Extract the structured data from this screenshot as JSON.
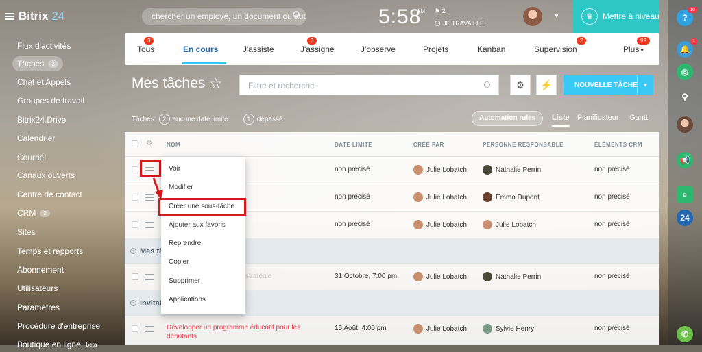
{
  "app": {
    "brand_main": "Bitrix",
    "brand_accent": "24",
    "accent": "#2fc6f6",
    "brand_color": "#2fc7c6",
    "danger": "#d7191b"
  },
  "header": {
    "search_placeholder": "chercher un employé, un document ou autre...",
    "clock": "5:58",
    "ampm": "AM",
    "flag_count": "2",
    "work_status": "JE TRAVAILLE",
    "upgrade_label": "Mettre à niveau"
  },
  "sidebar": {
    "items": [
      {
        "label": "Flux d'activités"
      },
      {
        "label": "Tâches",
        "count": "3"
      },
      {
        "label": "Chat et Appels"
      },
      {
        "label": "Groupes de travail"
      },
      {
        "label": "Bitrix24.Drive"
      },
      {
        "label": "Calendrier"
      },
      {
        "label": "Courriel"
      },
      {
        "label": "Canaux ouverts"
      },
      {
        "label": "Centre de contact"
      },
      {
        "label": "CRM",
        "count": "2"
      },
      {
        "label": "Sites"
      },
      {
        "label": "Temps et rapports"
      },
      {
        "label": "Abonnement"
      },
      {
        "label": "Utilisateurs"
      },
      {
        "label": "Paramètres"
      },
      {
        "label": "Procédure d'entreprise"
      },
      {
        "label": "Boutique en ligne",
        "sup": "beta"
      }
    ]
  },
  "tabs": {
    "items": [
      {
        "label": "Tous",
        "badge": "3"
      },
      {
        "label": "En cours"
      },
      {
        "label": "J'assiste"
      },
      {
        "label": "J'assigne",
        "badge": "3"
      },
      {
        "label": "J'observe"
      },
      {
        "label": "Projets"
      },
      {
        "label": "Kanban"
      },
      {
        "label": "Supervision",
        "badge": "2"
      },
      {
        "label": "Plus",
        "badge": "99"
      }
    ]
  },
  "page": {
    "title": "Mes tâches",
    "filter_placeholder": "Filtre et recherche",
    "new_task_label": "NOUVELLE TÂCHE",
    "counters_label": "Tâches:",
    "counter1_num": "2",
    "counter1_label": "aucune date limite",
    "counter2_num": "1",
    "counter2_label": "dépassé",
    "automation_label": "Automation rules",
    "views": [
      "Liste",
      "Planificateur",
      "Gantt"
    ]
  },
  "grid": {
    "columns": [
      "NOM",
      "DATE LIMITE",
      "CRÉÉ PAR",
      "PERSONNE RESPONSABLE",
      "ÉLÉMENTS CRM"
    ],
    "rows": [
      {
        "deadline": "non précisé",
        "creator": "Julie Lobatch",
        "responsible": "Nathalie Perrin",
        "crm": "non précisé"
      },
      {
        "deadline": "non précisé",
        "creator": "Julie Lobatch",
        "responsible": "Emma Dupont",
        "crm": "non précisé"
      },
      {
        "deadline": "non précisé",
        "creator": "Julie Lobatch",
        "responsible": "Julie Lobatch",
        "crm": "non précisé"
      }
    ],
    "group1": "Mes tâ",
    "group1_row": {
      "name": "stratégie",
      "deadline": "31 Octobre, 7:00 pm",
      "creator": "Julie Lobatch",
      "responsible": "Nathalie Perrin",
      "crm": "non précisé"
    },
    "group2": "Invitat",
    "group2_row": {
      "name_line1": "Développer un programme éducatif pour les",
      "name_line2": "débutants",
      "deadline": "15 Août, 4:00 pm",
      "creator": "Julie Lobatch",
      "responsible": "Sylvie Henry",
      "crm": "non précisé"
    }
  },
  "context_menu": {
    "items": [
      "Voir",
      "Modifier",
      "Créer une sous-tâche",
      "Ajouter aux favoris",
      "Reprendre",
      "Copier",
      "Supprimer",
      "Applications"
    ]
  },
  "rightbar": {
    "help_badge": "10",
    "bell_badge": "1",
    "open_label": "24"
  }
}
